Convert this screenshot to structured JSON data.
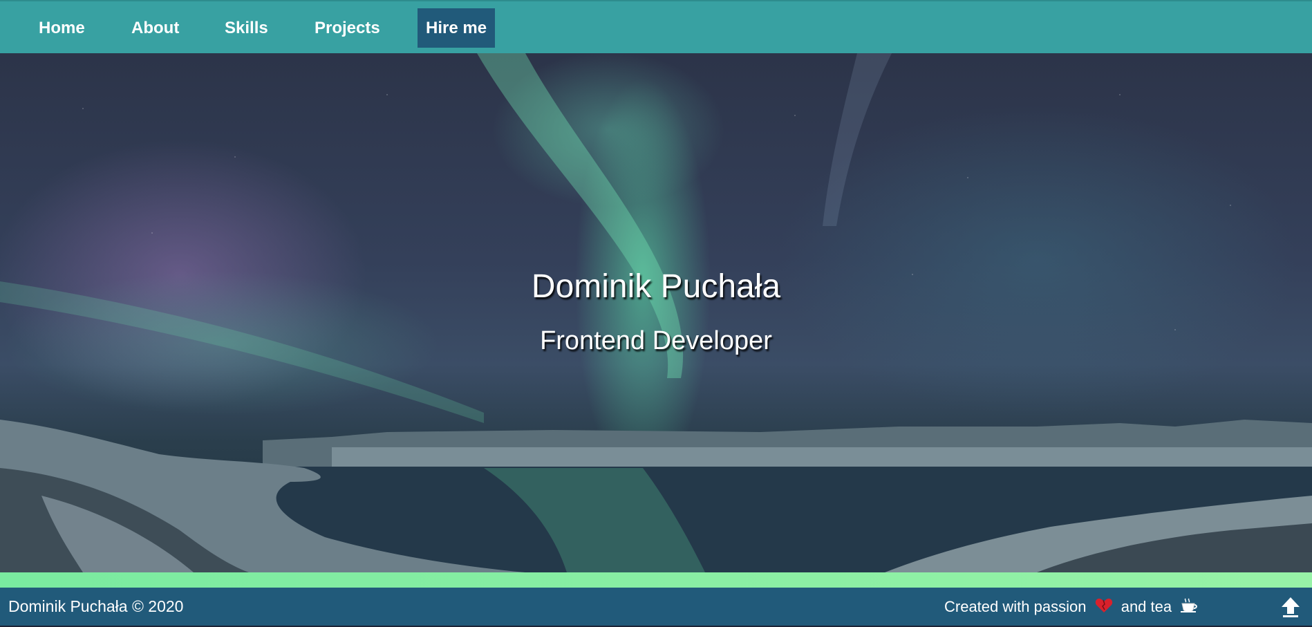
{
  "nav": {
    "items": [
      {
        "label": "Home"
      },
      {
        "label": "About"
      },
      {
        "label": "Skills"
      },
      {
        "label": "Projects"
      },
      {
        "label": "Hire me",
        "active": true
      }
    ]
  },
  "hero": {
    "name": "Dominik Puchała",
    "role": "Frontend Developer"
  },
  "footer": {
    "copyright": "Dominik Puchała © 2020",
    "credit_prefix": "Created with passion",
    "credit_middle": "and tea",
    "icons": [
      "heart-icon",
      "tea-cup-icon",
      "scroll-up-arrow-icon"
    ]
  },
  "colors": {
    "nav_bg": "#38a1a2",
    "active_nav_bg": "#215a7a",
    "footer_bg": "#215a7a",
    "accent_strip": "#8af0a4"
  }
}
